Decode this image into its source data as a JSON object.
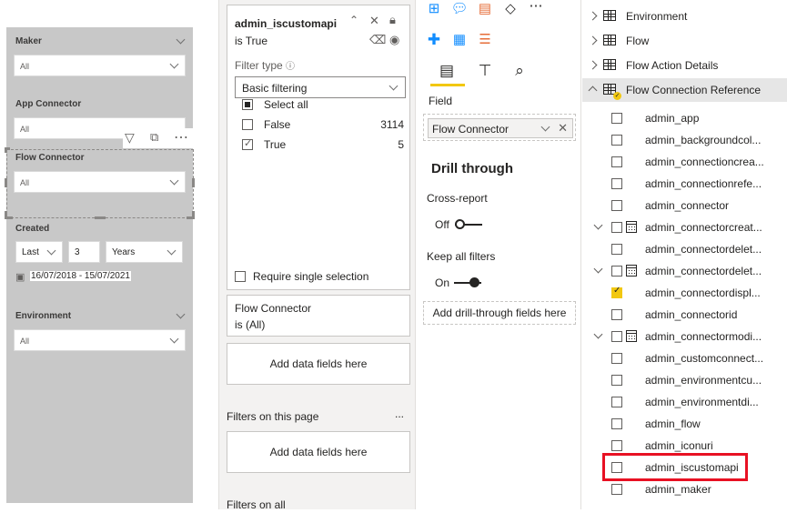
{
  "canvas": {
    "slicers": [
      {
        "title": "Maker",
        "value": "All"
      },
      {
        "title": "App Connector",
        "value": "All"
      },
      {
        "title": "Flow Connector",
        "value": "All"
      },
      {
        "title": "Environment",
        "value": "All"
      }
    ],
    "created": {
      "title": "Created",
      "relative": "Last",
      "count": "3",
      "unit": "Years",
      "range": "16/07/2018 - 15/07/2021"
    }
  },
  "filters": {
    "card": {
      "field": "admin_iscustomapi",
      "state": "is True",
      "filter_type_label": "Filter type",
      "filter_type_value": "Basic filtering",
      "options": [
        {
          "label": "Select all",
          "count": "",
          "state": "partial"
        },
        {
          "label": "False",
          "count": "3114",
          "state": "unchecked"
        },
        {
          "label": "True",
          "count": "5",
          "state": "checked"
        }
      ],
      "require_single": "Require single selection"
    },
    "flow_connector_card": {
      "title": "Flow Connector",
      "state": "is (All)"
    },
    "add_fields_1": "Add data fields here",
    "page_label": "Filters on this page",
    "page_more": "...",
    "add_fields_2": "Add data fields here",
    "all_pages_label": "Filters on all"
  },
  "viz": {
    "field_label": "Field",
    "field_value": "Flow Connector",
    "drill_title": "Drill through",
    "cross_report_label": "Cross-report",
    "cross_report_state": "Off",
    "keep_filters_label": "Keep all filters",
    "keep_filters_state": "On",
    "drill_zone": "Add drill-through fields here"
  },
  "fields": {
    "tables": [
      {
        "name": "Environment",
        "expanded": false
      },
      {
        "name": "Flow",
        "expanded": false
      },
      {
        "name": "Flow Action Details",
        "expanded": false
      },
      {
        "name": "Flow Connection Reference",
        "expanded": true
      }
    ],
    "columns": [
      {
        "name": "admin_app",
        "checked": false,
        "hierarchy": false
      },
      {
        "name": "admin_backgroundcol...",
        "checked": false,
        "hierarchy": false
      },
      {
        "name": "admin_connectioncrea...",
        "checked": false,
        "hierarchy": false
      },
      {
        "name": "admin_connectionrefe...",
        "checked": false,
        "hierarchy": false
      },
      {
        "name": "admin_connector",
        "checked": false,
        "hierarchy": false
      },
      {
        "name": "admin_connectorcreat...",
        "checked": false,
        "hierarchy": true
      },
      {
        "name": "admin_connectordelet...",
        "checked": false,
        "hierarchy": false
      },
      {
        "name": "admin_connectordelet...",
        "checked": false,
        "hierarchy": true
      },
      {
        "name": "admin_connectordispl...",
        "checked": true,
        "hierarchy": false
      },
      {
        "name": "admin_connectorid",
        "checked": false,
        "hierarchy": false
      },
      {
        "name": "admin_connectormodi...",
        "checked": false,
        "hierarchy": true
      },
      {
        "name": "admin_customconnect...",
        "checked": false,
        "hierarchy": false
      },
      {
        "name": "admin_environmentcu...",
        "checked": false,
        "hierarchy": false
      },
      {
        "name": "admin_environmentdi...",
        "checked": false,
        "hierarchy": false
      },
      {
        "name": "admin_flow",
        "checked": false,
        "hierarchy": false
      },
      {
        "name": "admin_iconuri",
        "checked": false,
        "hierarchy": false
      },
      {
        "name": "admin_iscustomapi",
        "checked": false,
        "hierarchy": false
      },
      {
        "name": "admin_maker",
        "checked": false,
        "hierarchy": false
      }
    ]
  },
  "colors": {
    "accent": "#f2c811",
    "highlight": "#e81123",
    "canvas": "#c8c8c8"
  }
}
